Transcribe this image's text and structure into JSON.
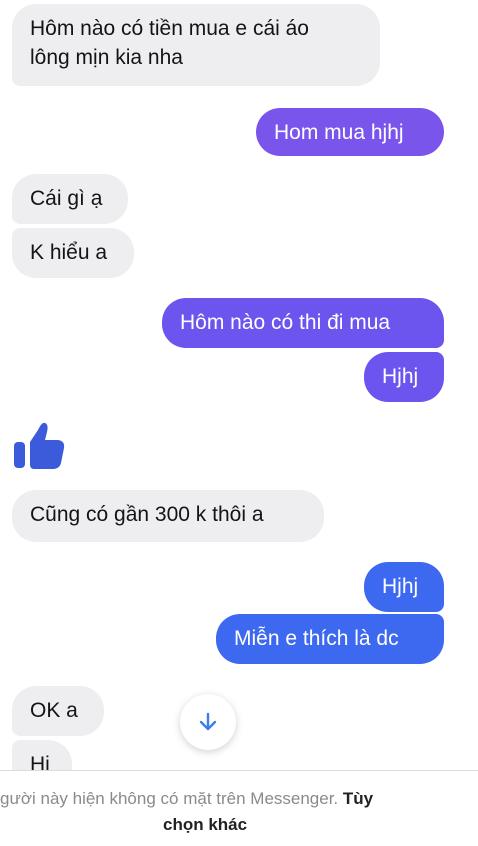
{
  "messages": {
    "m1_line1": "Hôm nào có tiền mua e cái áo",
    "m1_line2": "lông mịn kia nha",
    "m2": "Hom mua hjhj",
    "m3": "Cái gì ạ",
    "m4": "K hiểu a",
    "m5": "Hôm nào có thi đi mua",
    "m6": "Hjhj",
    "m7": "Cũng có gần 300 k thôi a",
    "m8": "Hjhj",
    "m9": "Miễn e thích là dc",
    "m10": "OK a",
    "m11": "Hi"
  },
  "icons": {
    "like": "thumbs-up-icon",
    "scroll": "arrow-down-icon"
  },
  "colors": {
    "incoming_bubble": "#eeeef0",
    "outgoing_purple": "#7a55ec",
    "outgoing_violet": "#6b55ee",
    "outgoing_blue": "#3d68f0",
    "like_icon": "#3b5bdb",
    "scroll_arrow": "#3b7bf0"
  },
  "footer": {
    "notice": "gười này hiện không có mặt trên Messenger.",
    "options_part1": "Tùy",
    "options_part2": "chọn khác"
  }
}
